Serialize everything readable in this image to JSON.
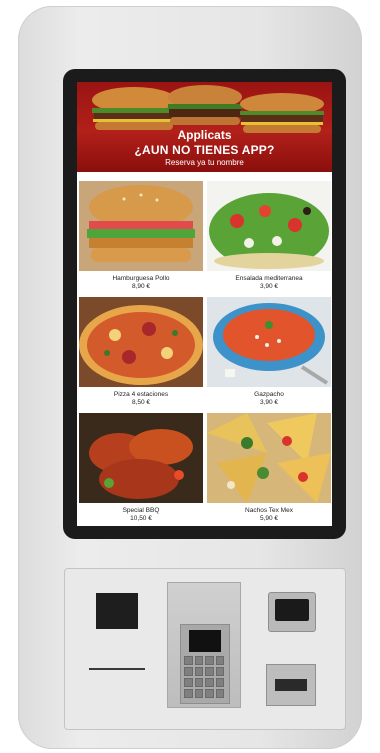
{
  "banner": {
    "brand": "Applicats",
    "headline": "¿AUN NO TIENES APP?",
    "subtitle": "Reserva ya tu nombre"
  },
  "menu": {
    "items": [
      {
        "name": "Hamburguesa Pollo",
        "price": "8,90 €",
        "icon": "burger"
      },
      {
        "name": "Ensalada mediterranea",
        "price": "3,90 €",
        "icon": "salad"
      },
      {
        "name": "Pizza 4 estaciones",
        "price": "8,50 €",
        "icon": "pizza"
      },
      {
        "name": "Gazpacho",
        "price": "3,90 €",
        "icon": "soup"
      },
      {
        "name": "Special BBQ",
        "price": "10,50 €",
        "icon": "chicken-wings"
      },
      {
        "name": "Nachos Tex Mex",
        "price": "5,90 €",
        "icon": "nachos"
      }
    ]
  },
  "colors": {
    "banner_red": "#b2201a",
    "bezel": "#1b1b1b",
    "kiosk_body": "#e6e6e6"
  }
}
